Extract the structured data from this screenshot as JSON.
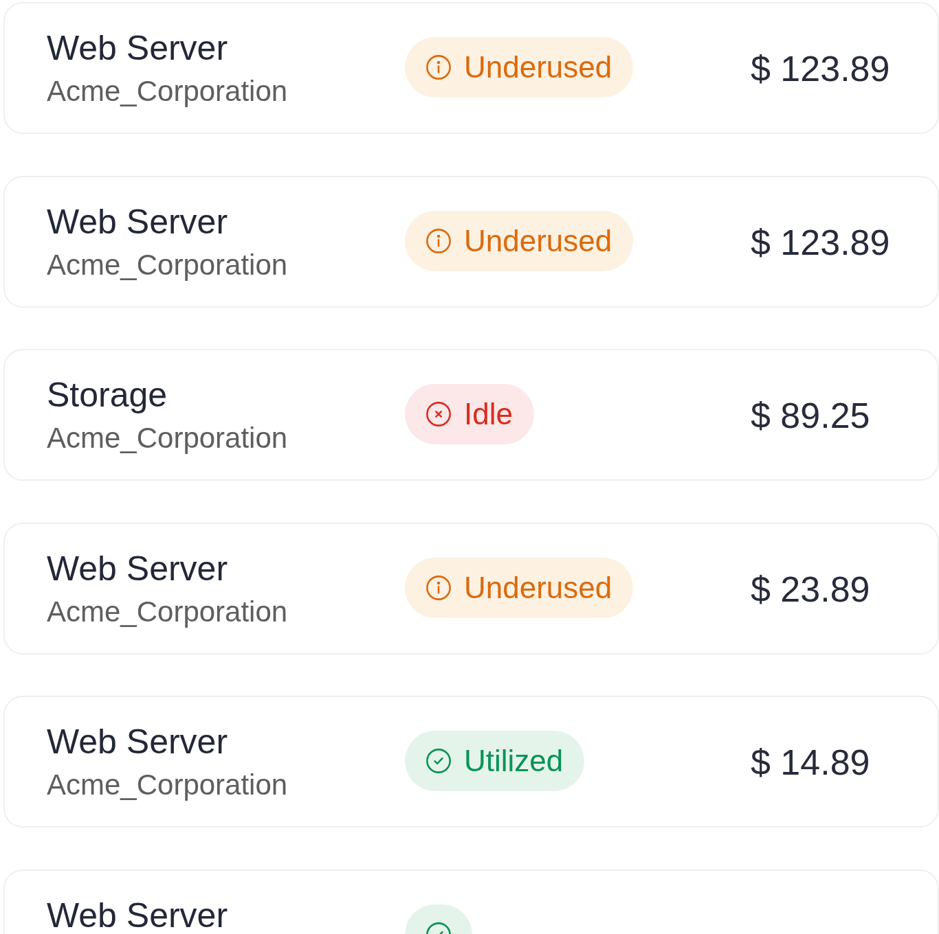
{
  "rows": [
    {
      "name": "Web Server",
      "company": "Acme_Corporation",
      "status": {
        "kind": "underused",
        "label": "Underused"
      },
      "price": "$ 123.89"
    },
    {
      "name": "Web Server",
      "company": "Acme_Corporation",
      "status": {
        "kind": "underused",
        "label": "Underused"
      },
      "price": "$ 123.89"
    },
    {
      "name": "Storage",
      "company": "Acme_Corporation",
      "status": {
        "kind": "idle",
        "label": "Idle"
      },
      "price": "$ 89.25"
    },
    {
      "name": "Web Server",
      "company": "Acme_Corporation",
      "status": {
        "kind": "underused",
        "label": "Underused"
      },
      "price": "$ 23.89"
    },
    {
      "name": "Web Server",
      "company": "Acme_Corporation",
      "status": {
        "kind": "utilized",
        "label": "Utilized"
      },
      "price": "$ 14.89"
    },
    {
      "name": "Web Server",
      "status": {
        "kind": "utilized"
      }
    }
  ]
}
